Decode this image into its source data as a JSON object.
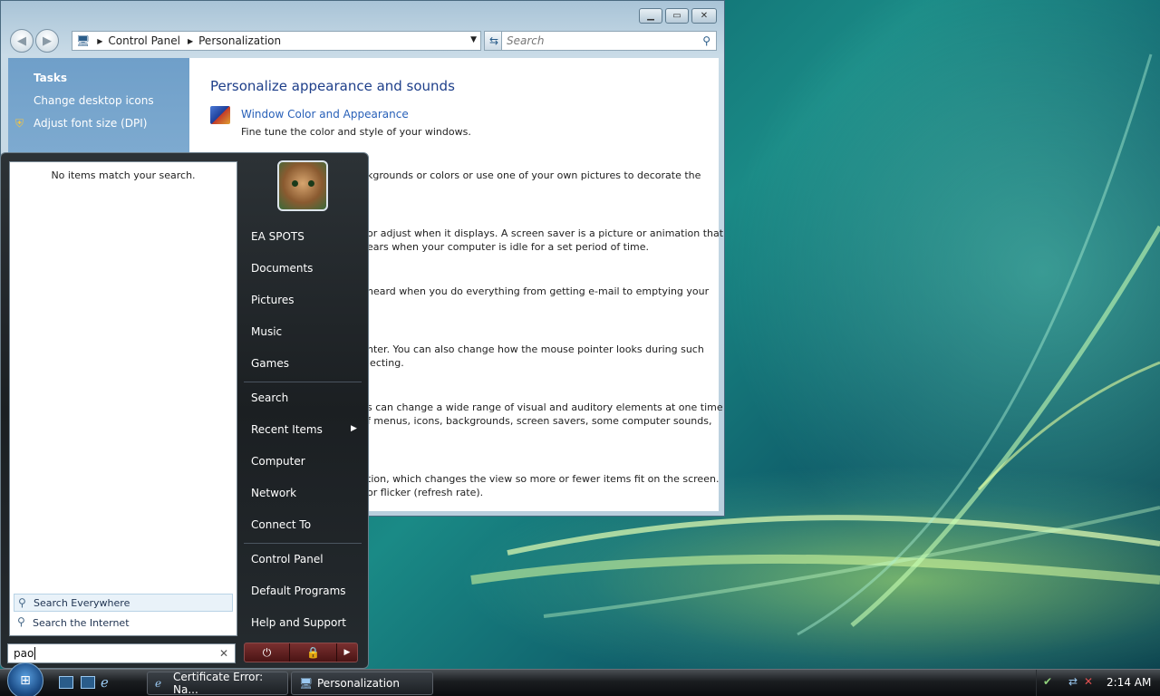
{
  "control_panel": {
    "breadcrumb": [
      "Control Panel",
      "Personalization"
    ],
    "search_placeholder": "Search",
    "sidebar": {
      "heading": "Tasks",
      "links": [
        "Change desktop icons",
        "Adjust font size (DPI)"
      ]
    },
    "main": {
      "heading": "Personalize appearance and sounds",
      "first_item": {
        "title": "Window Color and Appearance",
        "desc": "Fine tune the color and style of your windows."
      },
      "partial_lines": [
        "kgrounds or colors or use one of your own pictures to decorate the",
        "or adjust when it displays. A screen saver is a picture or animation that",
        "ears when your computer is idle for a set period of time.",
        "heard when you do everything from getting e-mail to emptying your",
        "nter. You can also change how the mouse pointer looks during such",
        "lecting.",
        "s can change a wide range of visual and auditory elements at one time",
        "f menus, icons, backgrounds, screen savers, some computer sounds,",
        "tion, which changes the view so more or fewer items fit on the screen.",
        "or flicker (refresh rate)."
      ]
    }
  },
  "start_menu": {
    "no_items_text": "No items match your search.",
    "search_everywhere": "Search Everywhere",
    "search_internet": "Search the Internet",
    "search_value": "pao",
    "right_items": [
      "EA SPOTS",
      "Documents",
      "Pictures",
      "Music",
      "Games",
      "Search",
      "Recent Items",
      "Computer",
      "Network",
      "Connect To",
      "Control Panel",
      "Default Programs",
      "Help and Support"
    ]
  },
  "taskbar": {
    "tasks": [
      "Certificate Error: Na...",
      "Personalization"
    ],
    "clock": "2:14 AM"
  }
}
